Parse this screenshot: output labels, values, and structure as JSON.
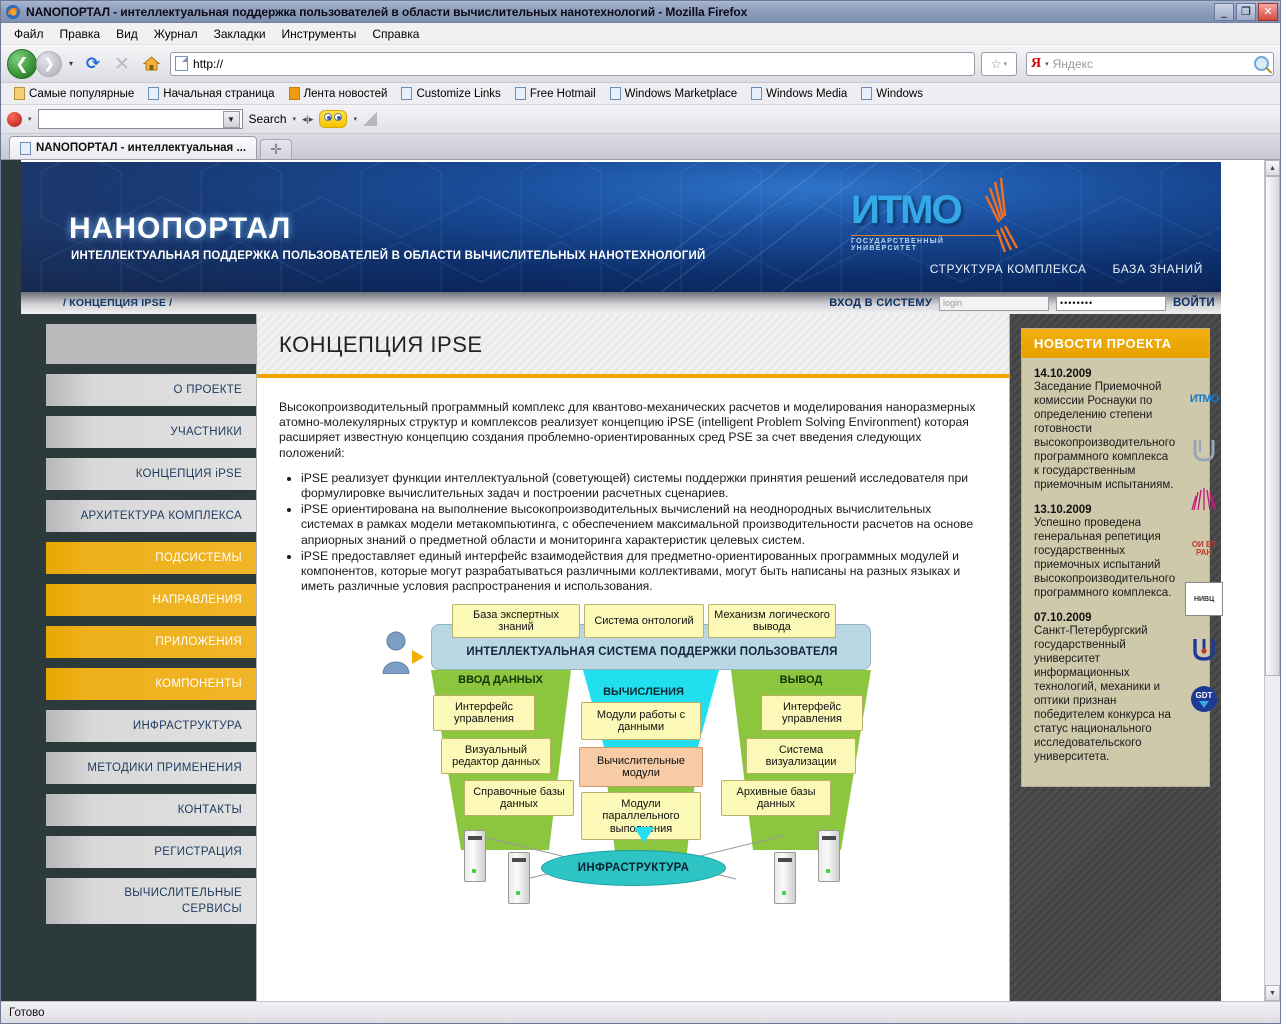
{
  "window": {
    "title": "NANOПОРТАЛ - интеллектуальная поддержка пользователей в области вычислительных нанотехнологий - Mozilla Firefox",
    "minimize_label": "_",
    "restore_label": "❐",
    "close_label": "✕"
  },
  "menubar": [
    {
      "label": "Файл"
    },
    {
      "label": "Правка"
    },
    {
      "label": "Вид"
    },
    {
      "label": "Журнал"
    },
    {
      "label": "Закладки"
    },
    {
      "label": "Инструменты"
    },
    {
      "label": "Справка"
    }
  ],
  "toolbar": {
    "back_icon": "back-arrow-icon",
    "forward_icon": "forward-arrow-icon",
    "reload_glyph": "⟳",
    "stop_glyph": "✕",
    "home_glyph": "⌂",
    "url_value": "http://",
    "url_placeholder": "http://",
    "star_glyph": "☆",
    "caret_glyph": "▾",
    "search_engine": "Я",
    "search_placeholder": "Яндекс",
    "search_value": ""
  },
  "bookmarks": [
    {
      "label": "Самые популярные",
      "icon": "folder-icon"
    },
    {
      "label": "Начальная страница",
      "icon": "page-icon"
    },
    {
      "label": "Лента новостей",
      "icon": "rss-icon"
    },
    {
      "label": "Customize Links",
      "icon": "page-icon"
    },
    {
      "label": "Free Hotmail",
      "icon": "page-icon"
    },
    {
      "label": "Windows Marketplace",
      "icon": "page-icon"
    },
    {
      "label": "Windows Media",
      "icon": "page-icon"
    },
    {
      "label": "Windows",
      "icon": "page-icon"
    }
  ],
  "addonbar": {
    "toolbar_icon": "red-ball-icon",
    "input_value": "",
    "search_label": "Search",
    "smiley_icon": "smiley-icon",
    "triangle_icon": "gray-triangle-icon"
  },
  "tabs": {
    "active_tab": "NANOПОРТАЛ - интеллектуальная ...",
    "new_tab_glyph": "✛"
  },
  "site": {
    "banner": {
      "title": "НАНОПОРТАЛ",
      "subtitle": "ИНТЕЛЛЕКТУАЛЬНАЯ ПОДДЕРЖКА ПОЛЬЗОВАТЕЛЕЙ В ОБЛАСТИ ВЫЧИСЛИТЕЛЬНЫХ НАНОТЕХНОЛОГИЙ",
      "logo_word": "ИТМО",
      "logo_sub": "ГОСУДАРСТВЕННЫЙ УНИВЕРСИТЕТ",
      "topnav": [
        {
          "label": "СТРУКТУРА КОМПЛЕКСА"
        },
        {
          "label": "БАЗА ЗНАНИЙ"
        }
      ]
    },
    "crumbbar": {
      "breadcrumb": "/ КОНЦЕПЦИЯ IPSE /",
      "login_label": "ВХОД В СИСТЕМУ",
      "login_placeholder": "login",
      "login_value": "",
      "password_value": "••••••••",
      "submit_label": "ВОЙТИ"
    },
    "sidebar": [
      {
        "label": "О ПРОЕКТЕ",
        "active": false
      },
      {
        "label": "УЧАСТНИКИ",
        "active": false
      },
      {
        "label": "КОНЦЕПЦИЯ iPSE",
        "active": false
      },
      {
        "label": "АРХИТЕКТУРА КОМПЛЕКСА",
        "active": false
      },
      {
        "label": "ПОДСИСТЕМЫ",
        "active": true
      },
      {
        "label": "НАПРАВЛЕНИЯ",
        "active": true
      },
      {
        "label": "ПРИЛОЖЕНИЯ",
        "active": true
      },
      {
        "label": "КОМПОНЕНТЫ",
        "active": true
      },
      {
        "label": "ИНФРАСТРУКТУРА",
        "active": false
      },
      {
        "label": "МЕТОДИКИ ПРИМЕНЕНИЯ",
        "active": false
      },
      {
        "label": "КОНТАКТЫ",
        "active": false
      },
      {
        "label": "РЕГИСТРАЦИЯ",
        "active": false
      },
      {
        "label": "ВЫЧИСЛИТЕЛЬНЫЕ",
        "label2": "СЕРВИСЫ",
        "active": false
      }
    ],
    "main": {
      "title": "КОНЦЕПЦИЯ IPSE",
      "intro": "Высокопроизводительный программный комплекс для квантово-механических расчетов и моделирования наноразмерных атомно-молекулярных структур и комплексов реализует концепцию iPSE (intelligent Problem Solving Environment) которая расширяет известную концепцию создания проблемно-ориентированных сред PSE за счет введения следующих положений:",
      "bullets": [
        "iPSE реализует функции интеллектуальной (советующей) системы поддержки принятия решений исследователя при формулировке вычислительных задач и построении расчетных сценариев.",
        "iPSE ориентирована на выполнение высокопроизводительных вычислений на неоднородных вычислительных системах в рамках модели метакомпьютинга, с обеспечением максимальной производительности расчетов на основе априорных знаний о предметной области и мониторинга характеристик целевых систем.",
        "iPSE предоставляет единый интерфейс взаимодействия для предметно-ориентированных программных модулей и компонентов, которые могут разрабатываться различными коллективами, могут быть написаны на разных языках и иметь различные условия распространения и использования."
      ]
    },
    "diagram": {
      "top_boxes": [
        "База экспертных знаний",
        "Система онтологий",
        "Механизм логического вывода"
      ],
      "band_label": "ИНТЕЛЛЕКТУАЛЬНАЯ СИСТЕМА ПОДДЕРЖКИ ПОЛЬЗОВАТЕЛЯ",
      "left_header": "ВВОД ДАННЫХ",
      "center_header": "ВЫЧИСЛЕНИЯ",
      "right_header": "ВЫВОД",
      "left_boxes": [
        "Интерфейс управления",
        "Визуальный редактор данных",
        "Справочные базы данных"
      ],
      "center_boxes": [
        "Модули работы с данными",
        "Вычислительные модули",
        "Модули параллельного выполнения"
      ],
      "right_boxes": [
        "Интерфейс управления",
        "Система визуализации",
        "Архивные базы данных"
      ],
      "infrastructure_label": "ИНФРАСТРУКТУРА",
      "user_icon": "user-avatar-icon",
      "arrow_icon": "right-arrow-icon"
    },
    "news": {
      "header": "НОВОСТИ ПРОЕКТА",
      "items": [
        {
          "date": "14.10.2009",
          "text": "Заседание Приемочной комиссии Роснауки по определению степени готовности высокопроизводительного программного комплекса к государственным приемочным испытаниям."
        },
        {
          "date": "13.10.2009",
          "text": "Успешно проведена генеральная репетиция государственных приемочных испытаний высокопроизводительного программного комплекса."
        },
        {
          "date": "07.10.2009",
          "text": "Санкт-Петербургский государственный университет информационных технологий, механики и оптики признан победителем конкурса на статус национального исследовательского университета."
        }
      ],
      "partner_logos": [
        {
          "name": "itmo-logo-icon",
          "text": "ИТМО"
        },
        {
          "name": "niivc-msu-logo-icon",
          "text": "ммU"
        },
        {
          "name": "mgu-star-logo-icon",
          "text": "✹"
        },
        {
          "name": "oivt-ran-logo-icon",
          "text": "ОИ ВТ РАН"
        },
        {
          "name": "nivc-logo-icon",
          "text": "НИВЦ"
        },
        {
          "name": "spbu-logo-icon",
          "text": "Ш"
        },
        {
          "name": "gdt-logo-icon",
          "text": "GDT"
        }
      ]
    }
  },
  "scrollbar": {
    "up_glyph": "▲",
    "down_glyph": "▼"
  },
  "statusbar": {
    "text": "Готово"
  },
  "colors": {
    "accent_orange": "#f0a500",
    "banner_blue": "#0d2f6b",
    "sidebar_dark": "#2c3a3c",
    "news_bg": "#cfc9ac"
  }
}
